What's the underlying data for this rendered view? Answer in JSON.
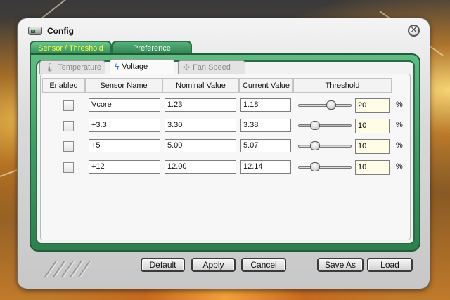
{
  "window": {
    "title": "Config",
    "title_icon": "disk-config-icon",
    "close_icon": "close-icon"
  },
  "main_tabs": [
    {
      "label": "Sensor / Threshold",
      "active": true
    },
    {
      "label": "Preference",
      "active": false
    }
  ],
  "sub_tabs": [
    {
      "label": "Temperature",
      "icon": "thermometer-icon",
      "active": false
    },
    {
      "label": "Voltage",
      "icon": "lightning-icon",
      "active": true
    },
    {
      "label": "Fan Speed",
      "icon": "fan-icon",
      "active": false
    }
  ],
  "table": {
    "headers": [
      "Enabled",
      "Sensor Name",
      "Nominal Value",
      "Current Value",
      "Threshold"
    ],
    "rows": [
      {
        "enabled": false,
        "name": "Vcore",
        "nominal": "1.23",
        "current": "1.18",
        "threshold": "20",
        "threshold_level": 0.62,
        "unit": "%"
      },
      {
        "enabled": false,
        "name": "+3.3",
        "nominal": "3.30",
        "current": "3.38",
        "threshold": "10",
        "threshold_level": 0.31,
        "unit": "%"
      },
      {
        "enabled": false,
        "name": "+5",
        "nominal": "5.00",
        "current": "5.07",
        "threshold": "10",
        "threshold_level": 0.31,
        "unit": "%"
      },
      {
        "enabled": false,
        "name": "+12",
        "nominal": "12.00",
        "current": "12.14",
        "threshold": "10",
        "threshold_level": 0.31,
        "unit": "%"
      }
    ]
  },
  "buttons": {
    "default": "Default",
    "apply": "Apply",
    "cancel": "Cancel",
    "save_as": "Save As",
    "load": "Load"
  },
  "colors": {
    "frame_green": "#3e9c63",
    "active_tab_text": "#ffff3c",
    "threshold_field_bg": "#fffde6"
  }
}
